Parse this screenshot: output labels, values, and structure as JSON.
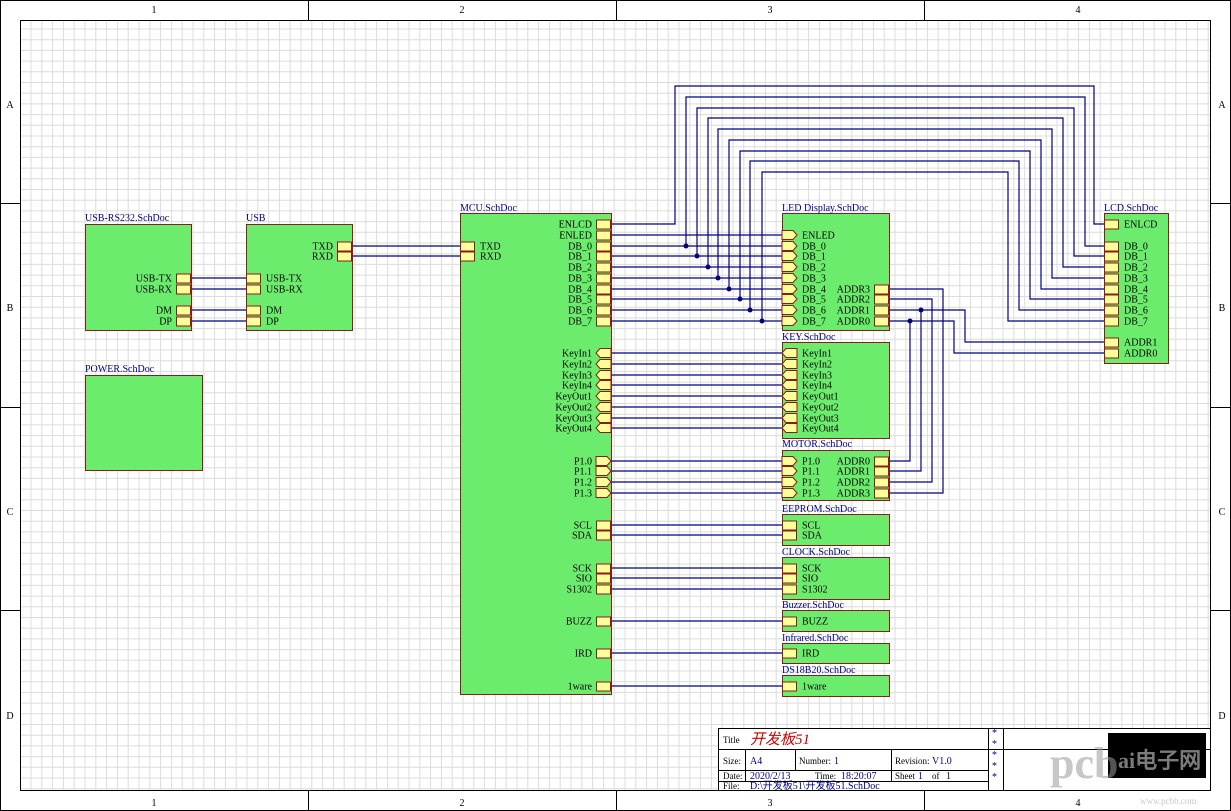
{
  "zones": {
    "cols": [
      "1",
      "2",
      "3",
      "4"
    ],
    "rows": [
      "A",
      "B",
      "C",
      "D"
    ]
  },
  "sheets": [
    {
      "id": "usbrs232",
      "name": "USB-RS232.SchDoc",
      "ports": [
        {
          "id": "usbrs232-usbtx",
          "label": "USB-TX",
          "shape": "rect"
        },
        {
          "id": "usbrs232-usbrx",
          "label": "USB-RX",
          "shape": "rect"
        },
        {
          "id": "usbrs232-dm",
          "label": "DM",
          "shape": "rect"
        },
        {
          "id": "usbrs232-dp",
          "label": "DP",
          "shape": "rect"
        }
      ]
    },
    {
      "id": "usb",
      "name": "USB",
      "ports": [
        {
          "id": "usb-txd",
          "label": "TXD",
          "shape": "rect"
        },
        {
          "id": "usb-rxd",
          "label": "RXD",
          "shape": "rect"
        },
        {
          "id": "usb-usbtx",
          "label": "USB-TX",
          "shape": "rect"
        },
        {
          "id": "usb-usbrx",
          "label": "USB-RX",
          "shape": "rect"
        },
        {
          "id": "usb-dm",
          "label": "DM",
          "shape": "rect"
        },
        {
          "id": "usb-dp",
          "label": "DP",
          "shape": "rect"
        }
      ]
    },
    {
      "id": "power",
      "name": "POWER.SchDoc",
      "ports": []
    },
    {
      "id": "mcu",
      "name": "MCU.SchDoc",
      "ports": [
        {
          "id": "mcu-enlcd",
          "label": "ENLCD",
          "shape": "rect"
        },
        {
          "id": "mcu-enled",
          "label": "ENLED",
          "shape": "rect"
        },
        {
          "id": "mcu-db0",
          "label": "DB_0",
          "shape": "rect"
        },
        {
          "id": "mcu-db1",
          "label": "DB_1",
          "shape": "rect"
        },
        {
          "id": "mcu-db2",
          "label": "DB_2",
          "shape": "rect"
        },
        {
          "id": "mcu-db3",
          "label": "DB_3",
          "shape": "rect"
        },
        {
          "id": "mcu-db4",
          "label": "DB_4",
          "shape": "rect"
        },
        {
          "id": "mcu-db5",
          "label": "DB_5",
          "shape": "rect"
        },
        {
          "id": "mcu-db6",
          "label": "DB_6",
          "shape": "rect"
        },
        {
          "id": "mcu-db7",
          "label": "DB_7",
          "shape": "rect"
        },
        {
          "id": "mcu-txd",
          "label": "TXD",
          "shape": "rect"
        },
        {
          "id": "mcu-rxd",
          "label": "RXD",
          "shape": "rect"
        },
        {
          "id": "mcu-keyin1",
          "label": "KeyIn1",
          "shape": "left"
        },
        {
          "id": "mcu-keyin2",
          "label": "KeyIn2",
          "shape": "left"
        },
        {
          "id": "mcu-keyin3",
          "label": "KeyIn3",
          "shape": "left"
        },
        {
          "id": "mcu-keyin4",
          "label": "KeyIn4",
          "shape": "left"
        },
        {
          "id": "mcu-keyout1",
          "label": "KeyOut1",
          "shape": "left"
        },
        {
          "id": "mcu-keyout2",
          "label": "KeyOut2",
          "shape": "left"
        },
        {
          "id": "mcu-keyout3",
          "label": "KeyOut3",
          "shape": "left"
        },
        {
          "id": "mcu-keyout4",
          "label": "KeyOut4",
          "shape": "left"
        },
        {
          "id": "mcu-p10",
          "label": "P1.0",
          "shape": "right"
        },
        {
          "id": "mcu-p11",
          "label": "P1.1",
          "shape": "right"
        },
        {
          "id": "mcu-p12",
          "label": "P1.2",
          "shape": "right"
        },
        {
          "id": "mcu-p13",
          "label": "P1.3",
          "shape": "right"
        },
        {
          "id": "mcu-scl",
          "label": "SCL",
          "shape": "rect"
        },
        {
          "id": "mcu-sda",
          "label": "SDA",
          "shape": "rect"
        },
        {
          "id": "mcu-sck",
          "label": "SCK",
          "shape": "rect"
        },
        {
          "id": "mcu-sio",
          "label": "SIO",
          "shape": "rect"
        },
        {
          "id": "mcu-s1302",
          "label": "S1302",
          "shape": "rect"
        },
        {
          "id": "mcu-buzz",
          "label": "BUZZ",
          "shape": "rect"
        },
        {
          "id": "mcu-ird",
          "label": "IRD",
          "shape": "rect"
        },
        {
          "id": "mcu-1ware",
          "label": "1ware",
          "shape": "rect"
        }
      ]
    },
    {
      "id": "led",
      "name": "LED Display.SchDoc",
      "ports": [
        {
          "id": "led-enled",
          "label": "ENLED",
          "shape": "right"
        },
        {
          "id": "led-db0",
          "label": "DB_0",
          "shape": "right"
        },
        {
          "id": "led-db1",
          "label": "DB_1",
          "shape": "right"
        },
        {
          "id": "led-db2",
          "label": "DB_2",
          "shape": "right"
        },
        {
          "id": "led-db3",
          "label": "DB_3",
          "shape": "right"
        },
        {
          "id": "led-db4",
          "label": "DB_4",
          "shape": "right"
        },
        {
          "id": "led-db5",
          "label": "DB_5",
          "shape": "right"
        },
        {
          "id": "led-db6",
          "label": "DB_6",
          "shape": "right"
        },
        {
          "id": "led-db7",
          "label": "DB_7",
          "shape": "right"
        },
        {
          "id": "led-addr3",
          "label": "ADDR3",
          "shape": "rect"
        },
        {
          "id": "led-addr2",
          "label": "ADDR2",
          "shape": "rect"
        },
        {
          "id": "led-addr1",
          "label": "ADDR1",
          "shape": "rect"
        },
        {
          "id": "led-addr0",
          "label": "ADDR0",
          "shape": "rect"
        }
      ]
    },
    {
      "id": "key",
      "name": "KEY.SchDoc",
      "ports": [
        {
          "id": "key-keyin1",
          "label": "KeyIn1",
          "shape": "left"
        },
        {
          "id": "key-keyin2",
          "label": "KeyIn2",
          "shape": "left"
        },
        {
          "id": "key-keyin3",
          "label": "KeyIn3",
          "shape": "left"
        },
        {
          "id": "key-keyin4",
          "label": "KeyIn4",
          "shape": "left"
        },
        {
          "id": "key-keyout1",
          "label": "KeyOut1",
          "shape": "left"
        },
        {
          "id": "key-keyout2",
          "label": "KeyOut2",
          "shape": "left"
        },
        {
          "id": "key-keyout3",
          "label": "KeyOut3",
          "shape": "left"
        },
        {
          "id": "key-keyout4",
          "label": "KeyOut4",
          "shape": "left"
        }
      ]
    },
    {
      "id": "motor",
      "name": "MOTOR.SchDoc",
      "ports": [
        {
          "id": "motor-p10",
          "label": "P1.0",
          "shape": "right"
        },
        {
          "id": "motor-p11",
          "label": "P1.1",
          "shape": "right"
        },
        {
          "id": "motor-p12",
          "label": "P1.2",
          "shape": "right"
        },
        {
          "id": "motor-p13",
          "label": "P1.3",
          "shape": "right"
        },
        {
          "id": "motor-addr0",
          "label": "ADDR0",
          "shape": "rect"
        },
        {
          "id": "motor-addr1",
          "label": "ADDR1",
          "shape": "rect"
        },
        {
          "id": "motor-addr2",
          "label": "ADDR2",
          "shape": "rect"
        },
        {
          "id": "motor-addr3",
          "label": "ADDR3",
          "shape": "rect"
        }
      ]
    },
    {
      "id": "eeprom",
      "name": "EEPROM.SchDoc",
      "ports": [
        {
          "id": "eeprom-scl",
          "label": "SCL",
          "shape": "rect"
        },
        {
          "id": "eeprom-sda",
          "label": "SDA",
          "shape": "rect"
        }
      ]
    },
    {
      "id": "clock",
      "name": "CLOCK.SchDoc",
      "ports": [
        {
          "id": "clock-sck",
          "label": "SCK",
          "shape": "rect"
        },
        {
          "id": "clock-sio",
          "label": "SIO",
          "shape": "rect"
        },
        {
          "id": "clock-s1302",
          "label": "S1302",
          "shape": "rect"
        }
      ]
    },
    {
      "id": "buzzer",
      "name": "Buzzer.SchDoc",
      "ports": [
        {
          "id": "buzzer-buzz",
          "label": "BUZZ",
          "shape": "rect"
        }
      ]
    },
    {
      "id": "infrared",
      "name": "Infrared.SchDoc",
      "ports": [
        {
          "id": "infrared-ird",
          "label": "IRD",
          "shape": "rect"
        }
      ]
    },
    {
      "id": "ds18b20",
      "name": "DS18B20.SchDoc",
      "ports": [
        {
          "id": "ds18b20-1ware",
          "label": "1ware",
          "shape": "rect"
        }
      ]
    },
    {
      "id": "lcd",
      "name": "LCD.SchDoc",
      "ports": [
        {
          "id": "lcd-enlcd",
          "label": "ENLCD",
          "shape": "rect"
        },
        {
          "id": "lcd-db0",
          "label": "DB_0",
          "shape": "rect"
        },
        {
          "id": "lcd-db1",
          "label": "DB_1",
          "shape": "rect"
        },
        {
          "id": "lcd-db2",
          "label": "DB_2",
          "shape": "rect"
        },
        {
          "id": "lcd-db3",
          "label": "DB_3",
          "shape": "rect"
        },
        {
          "id": "lcd-db4",
          "label": "DB_4",
          "shape": "rect"
        },
        {
          "id": "lcd-db5",
          "label": "DB_5",
          "shape": "rect"
        },
        {
          "id": "lcd-db6",
          "label": "DB_6",
          "shape": "rect"
        },
        {
          "id": "lcd-db7",
          "label": "DB_7",
          "shape": "rect"
        },
        {
          "id": "lcd-addr1",
          "label": "ADDR1",
          "shape": "rect"
        },
        {
          "id": "lcd-addr0",
          "label": "ADDR0",
          "shape": "rect"
        }
      ]
    }
  ],
  "title_block": {
    "title_label": "Title",
    "title_value": "开发板51",
    "size_label": "Size:",
    "size_value": "A4",
    "number_label": "Number:",
    "number_value": "1",
    "revision_label": "Revision:",
    "revision_value": "V1.0",
    "date_label": "Date:",
    "date_value": "2020/2/13",
    "time_label": "Time:",
    "time_value": "18:20:07",
    "sheet_label": "Sheet",
    "sheet_value": "1",
    "of_label": "of",
    "of_value": "1",
    "file_label": "File:",
    "file_value": "D:\\开发板51\\开发板51.SchDoc",
    "stars": [
      "*",
      "*",
      "*",
      "*",
      "*"
    ]
  },
  "watermark": {
    "text": "pcb",
    "text2": "ai电子网",
    "url": "www.pcbb.com"
  },
  "colors": {
    "block_fill": "#6cec6c",
    "block_border": "#8b1a1a",
    "port_fill": "#ffff99",
    "wire": "#000080",
    "sheet_name": "#000080",
    "title_red": "#cc0000"
  }
}
